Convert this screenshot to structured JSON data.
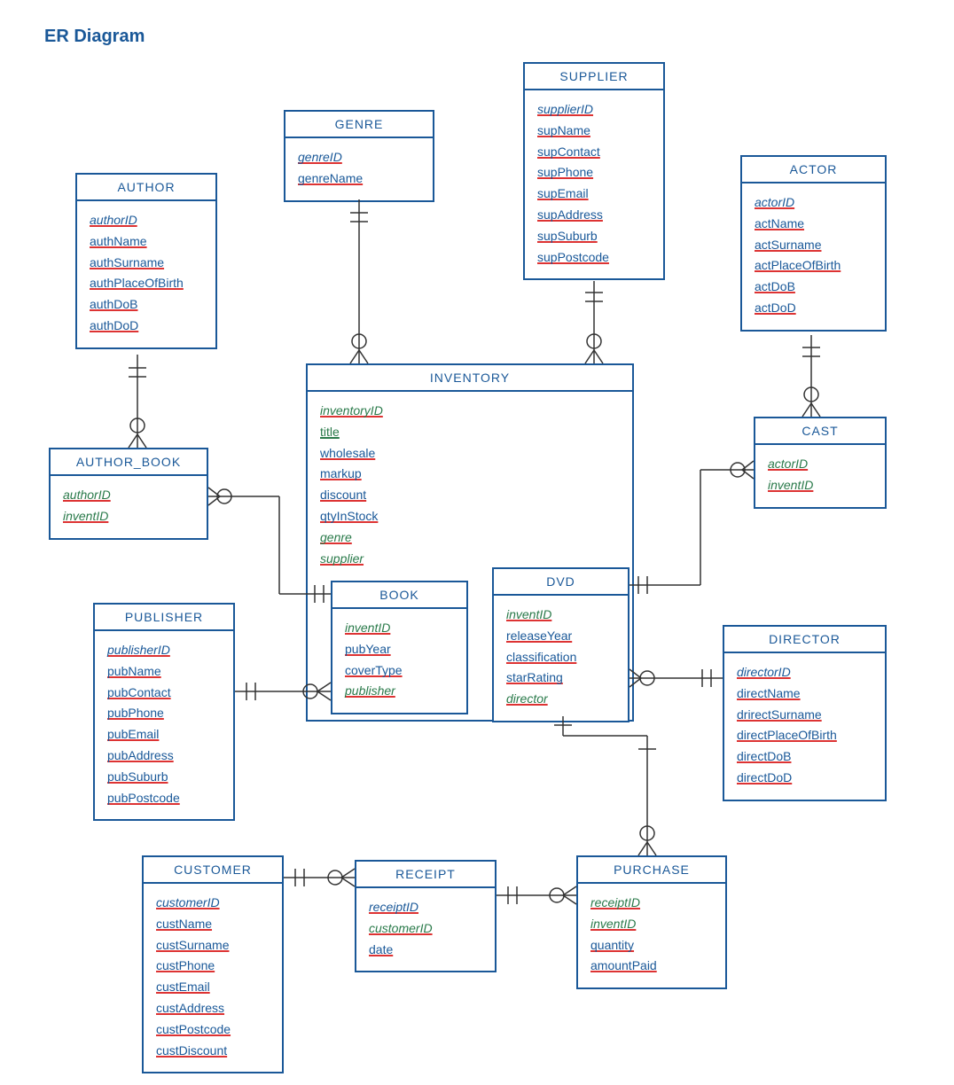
{
  "page_title": "ER Diagram",
  "chart_data": {
    "type": "er-diagram",
    "entities": [
      {
        "name": "AUTHOR",
        "attributes": [
          "authorID",
          "authName",
          "authSurname",
          "authPlaceOfBirth",
          "authDoB",
          "authDoD"
        ]
      },
      {
        "name": "AUTHOR_BOOK",
        "attributes": [
          "authorID",
          "inventID"
        ]
      },
      {
        "name": "GENRE",
        "attributes": [
          "genreID",
          "genreName"
        ]
      },
      {
        "name": "SUPPLIER",
        "attributes": [
          "supplierID",
          "supName",
          "supContact",
          "supPhone",
          "supEmail",
          "supAddress",
          "supSuburb",
          "supPostcode"
        ]
      },
      {
        "name": "ACTOR",
        "attributes": [
          "actorID",
          "actName",
          "actSurname",
          "actPlaceOfBirth",
          "actDoB",
          "actDoD"
        ]
      },
      {
        "name": "CAST",
        "attributes": [
          "actorID",
          "inventID"
        ]
      },
      {
        "name": "INVENTORY",
        "attributes": [
          "inventoryID",
          "title",
          "wholesale",
          "markup",
          "discount",
          "qtyInStock",
          "genre",
          "supplier"
        ]
      },
      {
        "name": "BOOK",
        "attributes": [
          "inventID",
          "pubYear",
          "coverType",
          "publisher"
        ]
      },
      {
        "name": "DVD",
        "attributes": [
          "inventID",
          "releaseYear",
          "classification",
          "starRating",
          "director"
        ]
      },
      {
        "name": "PUBLISHER",
        "attributes": [
          "publisherID",
          "pubName",
          "pubContact",
          "pubPhone",
          "pubEmail",
          "pubAddress",
          "pubSuburb",
          "pubPostcode"
        ]
      },
      {
        "name": "DIRECTOR",
        "attributes": [
          "directorID",
          "directName",
          "drirectSurname",
          "directPlaceOfBirth",
          "directDoB",
          "directDoD"
        ]
      },
      {
        "name": "CUSTOMER",
        "attributes": [
          "customerID",
          "custName",
          "custSurname",
          "custPhone",
          "custEmail",
          "custAddress",
          "custPostcode",
          "custDiscount"
        ]
      },
      {
        "name": "RECEIPT",
        "attributes": [
          "receiptID",
          "customerID",
          "date"
        ]
      },
      {
        "name": "PURCHASE",
        "attributes": [
          "receiptID",
          "inventID",
          "quantity",
          "amountPaid"
        ]
      }
    ],
    "relationships": [
      {
        "from": "AUTHOR",
        "to": "AUTHOR_BOOK",
        "card": "1:N"
      },
      {
        "from": "AUTHOR_BOOK",
        "to": "BOOK",
        "card": "N:1"
      },
      {
        "from": "GENRE",
        "to": "INVENTORY",
        "card": "1:N"
      },
      {
        "from": "SUPPLIER",
        "to": "INVENTORY",
        "card": "1:N"
      },
      {
        "from": "ACTOR",
        "to": "CAST",
        "card": "1:N"
      },
      {
        "from": "CAST",
        "to": "DVD",
        "card": "N:1"
      },
      {
        "from": "PUBLISHER",
        "to": "BOOK",
        "card": "1:N"
      },
      {
        "from": "DIRECTOR",
        "to": "DVD",
        "card": "1:N"
      },
      {
        "from": "INVENTORY",
        "to": "PURCHASE",
        "card": "1:N"
      },
      {
        "from": "CUSTOMER",
        "to": "RECEIPT",
        "card": "1:N"
      },
      {
        "from": "RECEIPT",
        "to": "PURCHASE",
        "card": "1:N"
      }
    ]
  },
  "entities": {
    "author": {
      "name": "AUTHOR",
      "attrs": [
        "authorID",
        "authName",
        "authSurname",
        "authPlaceOfBirth",
        "authDoB",
        "authDoD"
      ]
    },
    "author_book": {
      "name": "AUTHOR_BOOK",
      "attrs": [
        "authorID",
        "inventID"
      ]
    },
    "genre": {
      "name": "GENRE",
      "attrs": [
        "genreID",
        "genreName"
      ]
    },
    "supplier": {
      "name": "SUPPLIER",
      "attrs": [
        "supplierID",
        "supName",
        "supContact",
        "supPhone",
        "supEmail",
        "supAddress",
        "supSuburb",
        "supPostcode"
      ]
    },
    "actor": {
      "name": "ACTOR",
      "attrs": [
        "actorID",
        "actName",
        "actSurname",
        "actPlaceOfBirth",
        "actDoB",
        "actDoD"
      ]
    },
    "cast": {
      "name": "CAST",
      "attrs": [
        "actorID",
        "inventID"
      ]
    },
    "inventory": {
      "name": "INVENTORY",
      "attrs": [
        "inventoryID",
        "title",
        "wholesale",
        "markup",
        "discount",
        "qtyInStock",
        "genre",
        "supplier"
      ]
    },
    "book": {
      "name": "BOOK",
      "attrs": [
        "inventID",
        "pubYear",
        "coverType",
        "publisher"
      ]
    },
    "dvd": {
      "name": "DVD",
      "attrs": [
        "inventID",
        "releaseYear",
        "classification",
        "starRating",
        "director"
      ]
    },
    "publisher": {
      "name": "PUBLISHER",
      "attrs": [
        "publisherID",
        "pubName",
        "pubContact",
        "pubPhone",
        "pubEmail",
        "pubAddress",
        "pubSuburb",
        "pubPostcode"
      ]
    },
    "director": {
      "name": "DIRECTOR",
      "attrs": [
        "directorID",
        "directName",
        "drirectSurname",
        "directPlaceOfBirth",
        "directDoB",
        "directDoD"
      ]
    },
    "customer": {
      "name": "CUSTOMER",
      "attrs": [
        "customerID",
        "custName",
        "custSurname",
        "custPhone",
        "custEmail",
        "custAddress",
        "custPostcode",
        "custDiscount"
      ]
    },
    "receipt": {
      "name": "RECEIPT",
      "attrs": [
        "receiptID",
        "customerID",
        "date"
      ]
    },
    "purchase": {
      "name": "PURCHASE",
      "attrs": [
        "receiptID",
        "inventID",
        "quantity",
        "amountPaid"
      ]
    }
  }
}
